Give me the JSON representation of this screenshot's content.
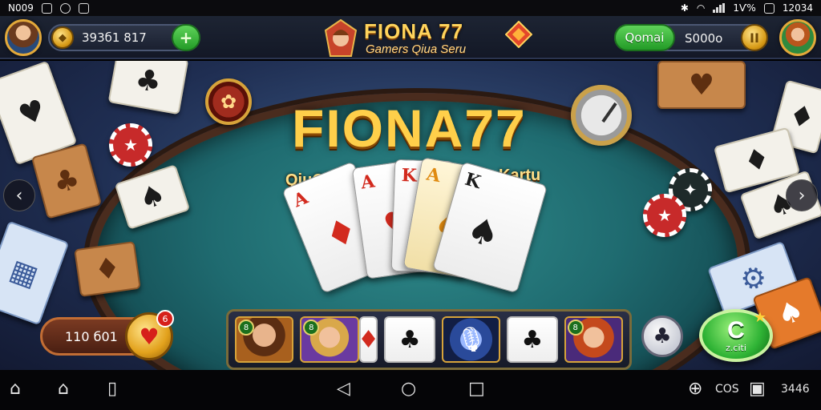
{
  "status_bar": {
    "left_text": "N009",
    "right_text": "1Ѵ%",
    "time": "12034"
  },
  "header": {
    "coins": "393б1 817",
    "coin_symbol": "◆",
    "add_label": "+",
    "logo_title": "FIONA 77",
    "logo_subtitle": "Gamers Qiua Seru",
    "qbutton_label": "Qomai",
    "balance_right": "S000o",
    "pause_label": "II"
  },
  "table": {
    "title": "FIONA77",
    "tag_left": "QiuQiu",
    "tag_right": "Kartu",
    "hand": [
      {
        "rank": "A",
        "suit": "♦",
        "color": "red"
      },
      {
        "rank": "A",
        "suit": "♥",
        "color": "red"
      },
      {
        "rank": "K",
        "suit": "♠",
        "color": "red"
      },
      {
        "rank": "A",
        "suit": "♠",
        "color": "cream"
      },
      {
        "rank": "K",
        "suit": "♠",
        "color": "black"
      }
    ],
    "nav_prev": "‹",
    "nav_next": "›"
  },
  "footer": {
    "balance": "110 б01",
    "heart_symbol": "♥",
    "notif": "6",
    "player_slots": [
      {
        "type": "avatar",
        "badge": "8"
      },
      {
        "type": "avatar",
        "badge": "8"
      },
      {
        "type": "card",
        "symbol": "♦",
        "color": "red"
      },
      {
        "type": "card",
        "symbol": "♣",
        "color": "black"
      },
      {
        "type": "avatar",
        "badge": ""
      },
      {
        "type": "card",
        "symbol": "♣",
        "color": "black"
      },
      {
        "type": "avatar",
        "badge": "8"
      }
    ],
    "spade_symbol": "♣",
    "play_big": "C",
    "play_label": "z.citi"
  },
  "nav_bar": {
    "left_icons": [
      "home-outline",
      "home",
      "back"
    ],
    "center_icons": [
      "back",
      "home-circle",
      "recents"
    ],
    "right_items": [
      "COS",
      "3446"
    ]
  }
}
